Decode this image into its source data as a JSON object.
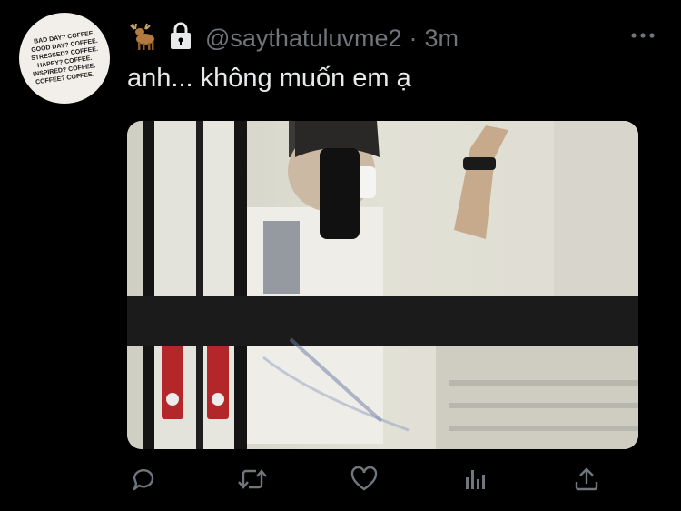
{
  "avatar": {
    "lines": [
      "BAD DAY? COFFEE.",
      "GOOD DAY? COFFEE.",
      "STRESSED? COFFEE.",
      "HAPPY? COFFEE.",
      "INSPIRED? COFFEE.",
      "COFFEE? COFFEE."
    ]
  },
  "tweet": {
    "handle": "@saythatuluvme2",
    "separator": "·",
    "time": "3m",
    "text": "anh... không muốn em ạ"
  },
  "icons": {
    "name_emoji": "deer-icon",
    "protected": "lock-icon",
    "more": "more-icon",
    "reply": "reply-icon",
    "retweet": "retweet-icon",
    "like": "heart-icon",
    "analytics": "analytics-icon",
    "share": "share-icon"
  },
  "colors": {
    "background": "#000000",
    "text": "#e7e9ea",
    "secondary": "#71767b"
  }
}
